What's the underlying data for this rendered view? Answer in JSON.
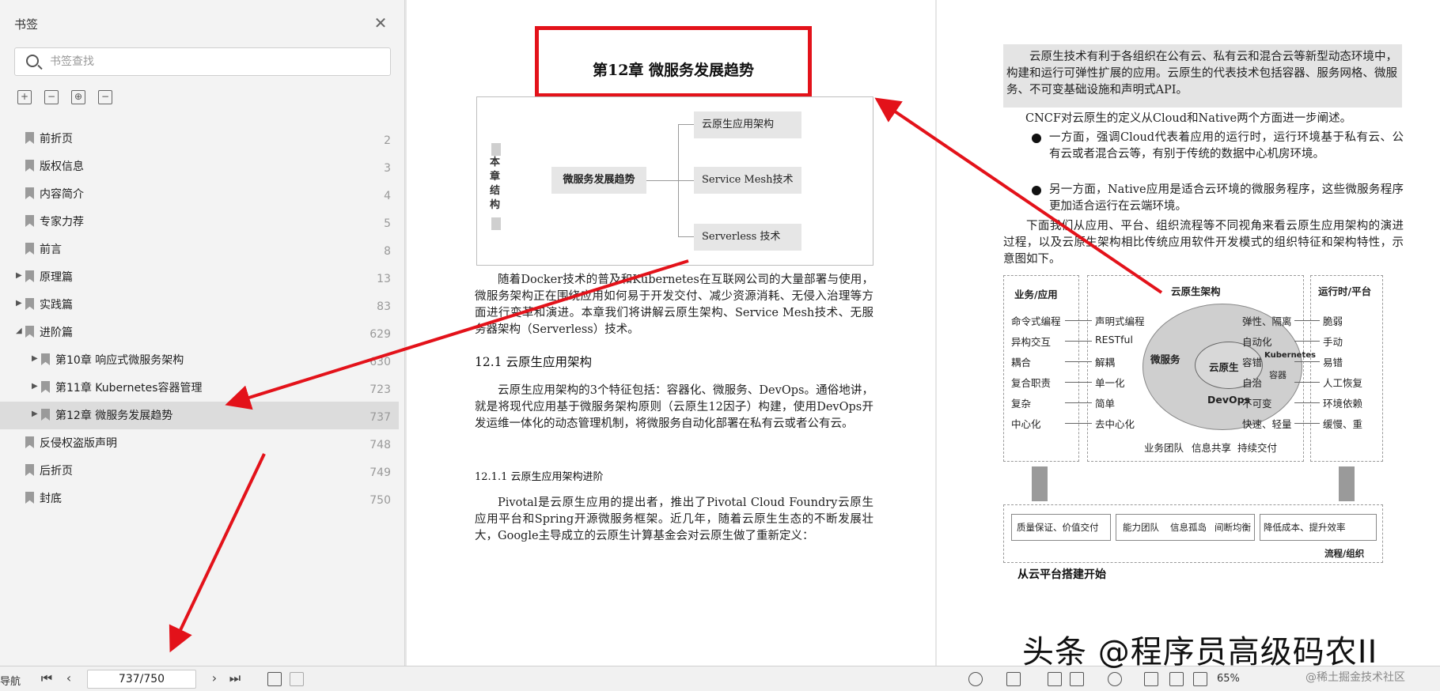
{
  "sidebar": {
    "title": "书签",
    "search_placeholder": "书签查找",
    "tools": [
      "expand-all-icon",
      "collapse-all-icon",
      "add-bookmark-icon",
      "delete-bookmark-icon"
    ],
    "items": [
      {
        "label": "前折页",
        "page": "2",
        "level": 0,
        "arrow": ""
      },
      {
        "label": "版权信息",
        "page": "3",
        "level": 0,
        "arrow": ""
      },
      {
        "label": "内容简介",
        "page": "4",
        "level": 0,
        "arrow": ""
      },
      {
        "label": "专家力荐",
        "page": "5",
        "level": 0,
        "arrow": ""
      },
      {
        "label": "前言",
        "page": "8",
        "level": 0,
        "arrow": ""
      },
      {
        "label": "原理篇",
        "page": "13",
        "level": 0,
        "arrow": "▶"
      },
      {
        "label": "实践篇",
        "page": "83",
        "level": 0,
        "arrow": "▶"
      },
      {
        "label": "进阶篇",
        "page": "629",
        "level": 0,
        "arrow": "◢"
      },
      {
        "label": "第10章 响应式微服务架构",
        "page": "630",
        "level": 1,
        "arrow": "▶"
      },
      {
        "label": "第11章 Kubernetes容器管理",
        "page": "723",
        "level": 1,
        "arrow": "▶"
      },
      {
        "label": "第12章 微服务发展趋势",
        "page": "737",
        "level": 1,
        "arrow": "▶",
        "selected": true
      },
      {
        "label": "反侵权盗版声明",
        "page": "748",
        "level": 0,
        "arrow": ""
      },
      {
        "label": "后折页",
        "page": "749",
        "level": 0,
        "arrow": ""
      },
      {
        "label": "封底",
        "page": "750",
        "level": 0,
        "arrow": ""
      }
    ]
  },
  "left_page": {
    "chapter_title": "第12章  微服务发展趋势",
    "diagram": {
      "side_label": "本章结构",
      "center": "微服务发展趋势",
      "branches": [
        "云原生应用架构",
        "Service Mesh技术",
        "Serverless 技术"
      ]
    },
    "para1": "随着Docker技术的普及和Kubernetes在互联网公司的大量部署与使用，微服务架构正在围绕应用如何易于开发交付、减少资源消耗、无侵入治理等方面进行变革和演进。本章我们将讲解云原生架构、Service Mesh技术、无服务器架构（Serverless）技术。",
    "h1": "12.1  云原生应用架构",
    "para2": "云原生应用架构的3个特征包括：容器化、微服务、DevOps。通俗地讲，就是将现代应用基于微服务架构原则（云原生12因子）构建，使用DevOps开发运维一体化的动态管理机制，将微服务自动化部署在私有云或者公有云。",
    "h2": "12.1.1  云原生应用架构进阶",
    "para3": "Pivotal是云原生应用的提出者，推出了Pivotal Cloud Foundry云原生应用平台和Spring开源微服务框架。近几年，随着云原生生态的不断发展壮大，Google主导成立的云原生计算基金会对云原生做了重新定义："
  },
  "right_page": {
    "quote": "云原生技术有利于各组织在公有云、私有云和混合云等新型动态环境中，构建和运行可弹性扩展的应用。云原生的代表技术包括容器、服务网格、微服务、不可变基础设施和声明式API。",
    "line1": "CNCF对云原生的定义从Cloud和Native两个方面进一步阐述。",
    "bullet1": "一方面，强调Cloud代表着应用的运行时，运行环境基于私有云、公有云或者混合云等，有别于传统的数据中心机房环境。",
    "bullet2": "另一方面，Native应用是适合云环境的微服务程序，这些微服务程序更加适合运行在云端环境。",
    "para": "下面我们从应用、平台、组织流程等不同视角来看云原生应用架构的演进过程，以及云原生架构相比传统应用软件开发模式的组织特征和架构特性，示意图如下。",
    "arch": {
      "left_title": "业务/应用",
      "left_items": [
        "命令式编程",
        "异构交互",
        "耦合",
        "复合职责",
        "复杂",
        "中心化"
      ],
      "mid_title": "云原生架构",
      "mid_left": [
        "声明式编程",
        "RESTful",
        "解耦",
        "单一化",
        "简单",
        "去中心化"
      ],
      "mid_right": [
        "弹性、隔离",
        "自动化",
        "容错",
        "自治",
        "不可变",
        "快速、轻量"
      ],
      "core": "云原生",
      "ring": [
        "微服务",
        "Kubernetes",
        "容器",
        "DevOps"
      ],
      "bottom_row": [
        "业务团队",
        "信息共享",
        "持续交付"
      ],
      "right_title": "运行时/平台",
      "right_items": [
        "脆弱",
        "手动",
        "易错",
        "人工恢复",
        "环境依赖",
        "缓慢、重"
      ],
      "low_boxes": [
        "质量保证、价值交付",
        "能力团队",
        "信息孤岛",
        "间断均衡",
        "降低成本、提升效率"
      ],
      "low_label": "流程/组织"
    },
    "caption": "从云平台搭建开始"
  },
  "statusbar": {
    "nav_label": "导航",
    "page_indicator": "737/750",
    "zoom": "65%"
  },
  "watermark": {
    "main": "头条 @程序员高级码农II",
    "sub": "@稀土掘金技术社区"
  },
  "colors": {
    "highlight_red": "#e3121a",
    "sidebar_bg": "#f3f3f3",
    "selected_row": "#dcdcdc"
  }
}
